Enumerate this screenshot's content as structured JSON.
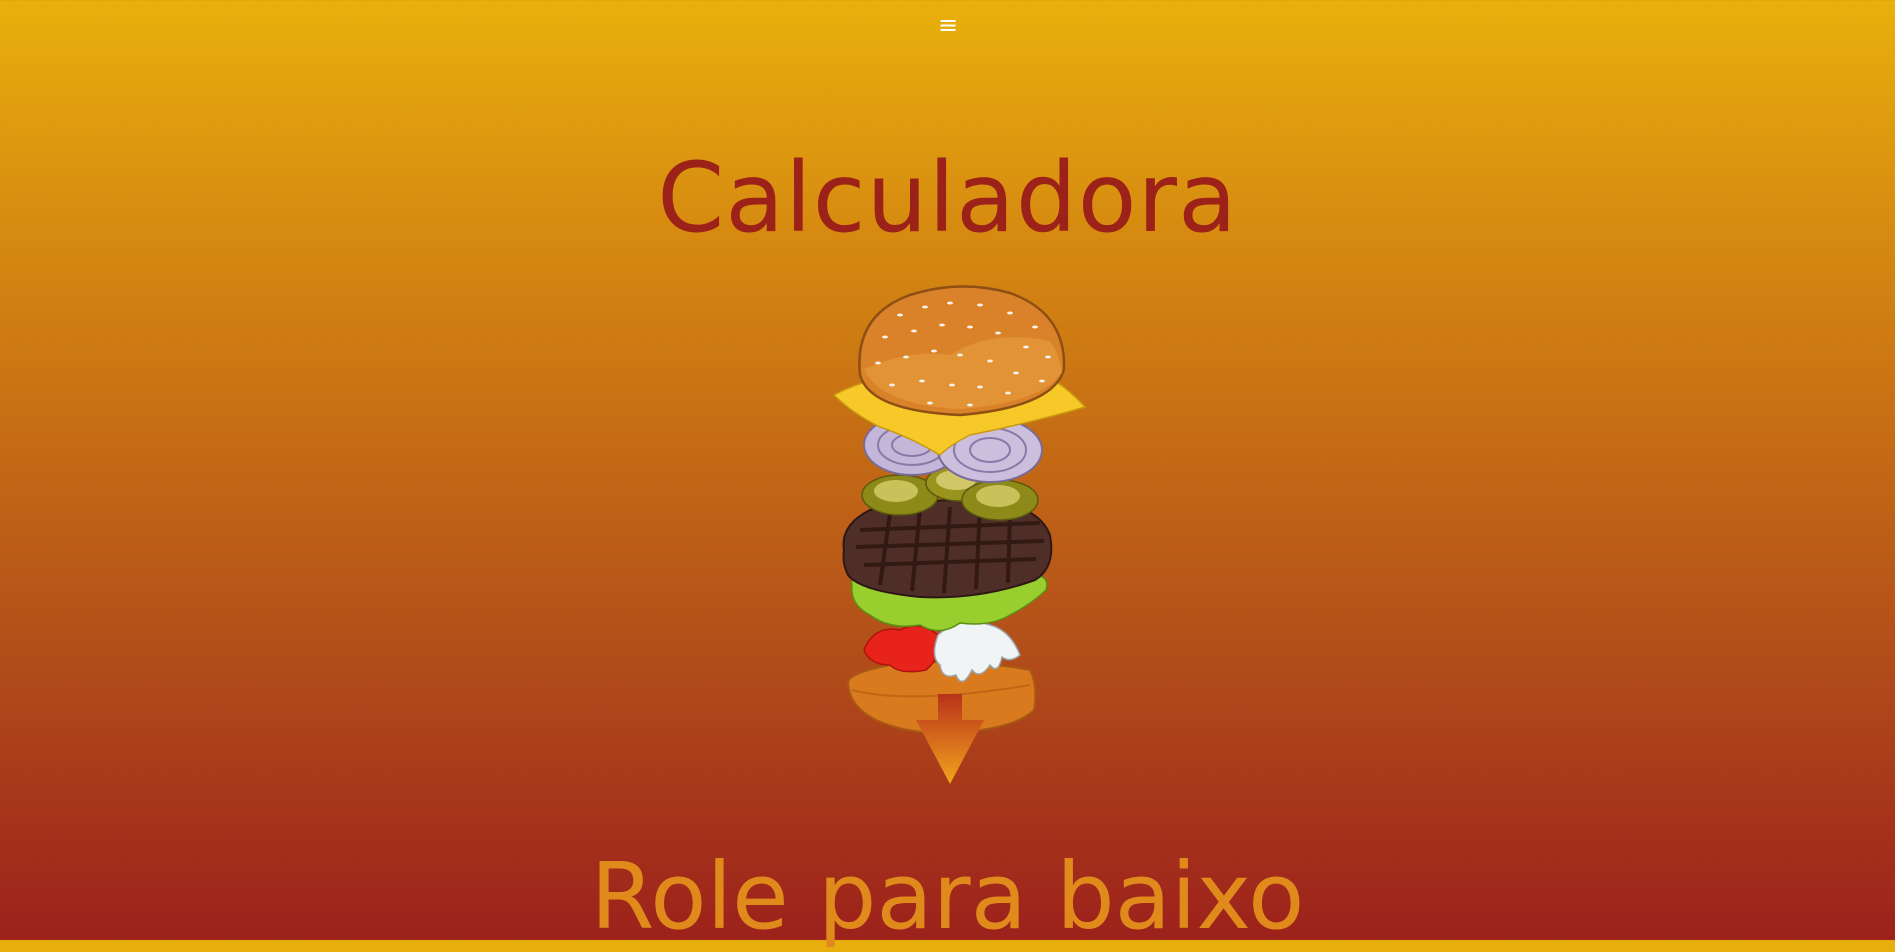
{
  "nav": {
    "menu_glyph": "≡",
    "menu_icon": "hamburger-menu-icon"
  },
  "hero": {
    "title": "Calculadora",
    "illustration": "burger-ingredients-illustration",
    "scroll_hint": "Role para baixo",
    "scroll_icon": "arrow-down-icon"
  },
  "colors": {
    "title": "#9c2118",
    "scroll_hint": "#e08a1c",
    "background_top": "#e8b00c",
    "background_bottom": "#9c211b"
  }
}
